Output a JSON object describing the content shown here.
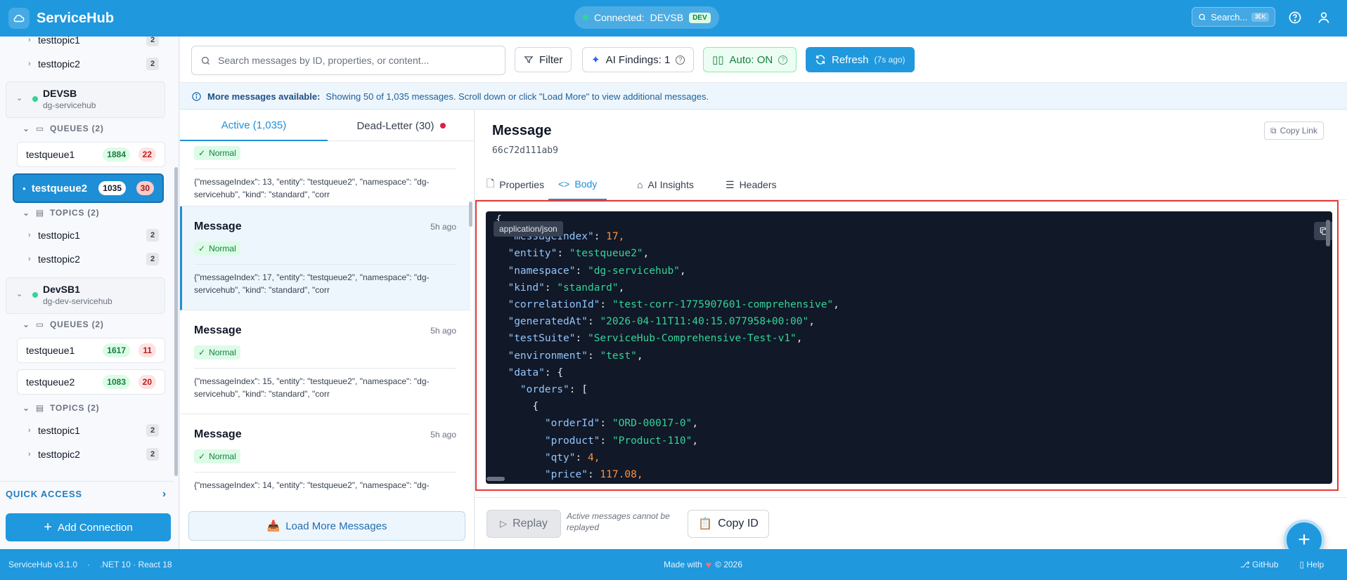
{
  "header": {
    "brand": "ServiceHub",
    "connection_label": "Connected:",
    "connection_name": "DEVSB",
    "env_badge": "DEV",
    "search_placeholder": "Search...",
    "search_shortcut": "⌘K"
  },
  "sidebar": {
    "top_topics": [
      {
        "name": "testtopic1",
        "count": "2"
      },
      {
        "name": "testtopic2",
        "count": "2"
      }
    ],
    "namespaces": [
      {
        "name": "DEVSB",
        "subtitle": "dg-servicehub",
        "queues_label": "QUEUES (2)",
        "queues": [
          {
            "name": "testqueue1",
            "active": "1884",
            "dead": "22"
          },
          {
            "name": "testqueue2",
            "active": "1035",
            "dead": "30"
          }
        ],
        "topics_label": "TOPICS (2)",
        "topics": [
          {
            "name": "testtopic1",
            "count": "2"
          },
          {
            "name": "testtopic2",
            "count": "2"
          }
        ]
      },
      {
        "name": "DevSB1",
        "subtitle": "dg-dev-servicehub",
        "queues_label": "QUEUES (2)",
        "queues": [
          {
            "name": "testqueue1",
            "active": "1617",
            "dead": "11"
          },
          {
            "name": "testqueue2",
            "active": "1083",
            "dead": "20"
          }
        ],
        "topics_label": "TOPICS (2)",
        "topics": [
          {
            "name": "testtopic1",
            "count": "2"
          },
          {
            "name": "testtopic2",
            "count": "2"
          }
        ]
      }
    ],
    "quick_access": "QUICK ACCESS",
    "add_connection": "Add Connection"
  },
  "toolbar": {
    "search_placeholder": "Search messages by ID, properties, or content...",
    "filter": "Filter",
    "ai_findings": "AI Findings: 1",
    "auto": "Auto: ON",
    "refresh": "Refresh",
    "refresh_age": "(7s ago)"
  },
  "banner": {
    "bold": "More messages available:",
    "text": "Showing 50 of 1,035 messages. Scroll down or click \"Load More\" to view additional messages."
  },
  "message_list": {
    "tab_active": "Active (1,035)",
    "tab_dead": "Dead-Letter (30)",
    "items": [
      {
        "title": "",
        "time": "",
        "priority": "Normal",
        "body": "{\"messageIndex\": 13, \"entity\": \"testqueue2\", \"namespace\": \"dg-servicehub\", \"kind\": \"standard\", \"corr"
      },
      {
        "title": "Message",
        "time": "5h ago",
        "priority": "Normal",
        "body": "{\"messageIndex\": 17, \"entity\": \"testqueue2\", \"namespace\": \"dg-servicehub\", \"kind\": \"standard\", \"corr"
      },
      {
        "title": "Message",
        "time": "5h ago",
        "priority": "Normal",
        "body": "{\"messageIndex\": 15, \"entity\": \"testqueue2\", \"namespace\": \"dg-servicehub\", \"kind\": \"standard\", \"corr"
      },
      {
        "title": "Message",
        "time": "5h ago",
        "priority": "Normal",
        "body": "{\"messageIndex\": 14, \"entity\": \"testqueue2\", \"namespace\": \"dg-"
      }
    ],
    "load_more": "Load More Messages"
  },
  "detail": {
    "title": "Message",
    "id": "66c72d111ab9",
    "copy_link": "Copy Link",
    "tabs": [
      "Properties",
      "Body",
      "AI Insights",
      "Headers"
    ],
    "mime": "application/json",
    "code": [
      {
        "indent": "",
        "key": "",
        "value": "{",
        "type": "p",
        "suffix": ""
      },
      {
        "indent": "  ",
        "key": "\"messageIndex\"",
        "value": "17",
        "type": "n",
        "suffix": ","
      },
      {
        "indent": "  ",
        "key": "\"entity\"",
        "value": "\"testqueue2\"",
        "type": "s",
        "suffix": ","
      },
      {
        "indent": "  ",
        "key": "\"namespace\"",
        "value": "\"dg-servicehub\"",
        "type": "s",
        "suffix": ","
      },
      {
        "indent": "  ",
        "key": "\"kind\"",
        "value": "\"standard\"",
        "type": "s",
        "suffix": ","
      },
      {
        "indent": "  ",
        "key": "\"correlationId\"",
        "value": "\"test-corr-1775907601-comprehensive\"",
        "type": "s",
        "suffix": ","
      },
      {
        "indent": "  ",
        "key": "\"generatedAt\"",
        "value": "\"2026-04-11T11:40:15.077958+00:00\"",
        "type": "s",
        "suffix": ","
      },
      {
        "indent": "  ",
        "key": "\"testSuite\"",
        "value": "\"ServiceHub-Comprehensive-Test-v1\"",
        "type": "s",
        "suffix": ","
      },
      {
        "indent": "  ",
        "key": "\"environment\"",
        "value": "\"test\"",
        "type": "s",
        "suffix": ","
      },
      {
        "indent": "  ",
        "key": "\"data\"",
        "value": "{",
        "type": "p",
        "suffix": ""
      },
      {
        "indent": "    ",
        "key": "\"orders\"",
        "value": "[",
        "type": "p",
        "suffix": ""
      },
      {
        "indent": "      ",
        "key": "",
        "value": "{",
        "type": "p",
        "suffix": ""
      },
      {
        "indent": "        ",
        "key": "\"orderId\"",
        "value": "\"ORD-00017-0\"",
        "type": "s",
        "suffix": ","
      },
      {
        "indent": "        ",
        "key": "\"product\"",
        "value": "\"Product-110\"",
        "type": "s",
        "suffix": ","
      },
      {
        "indent": "        ",
        "key": "\"qty\"",
        "value": "4",
        "type": "n",
        "suffix": ","
      },
      {
        "indent": "        ",
        "key": "\"price\"",
        "value": "117.08",
        "type": "n",
        "suffix": ","
      }
    ],
    "replay": "Replay",
    "replay_note": "Active messages cannot be replayed",
    "copy_id": "Copy ID"
  },
  "statusbar": {
    "version": "ServiceHub v3.1.0",
    "sep": "·",
    "stack": ".NET 10 · React 18",
    "made_with": "Made with",
    "copyright": "© 2026",
    "github": "GitHub",
    "help": "Help"
  },
  "colors": {
    "primary": "#1f98de",
    "success": "#15803d",
    "danger": "#b91c1c",
    "code_bg": "#111827"
  }
}
